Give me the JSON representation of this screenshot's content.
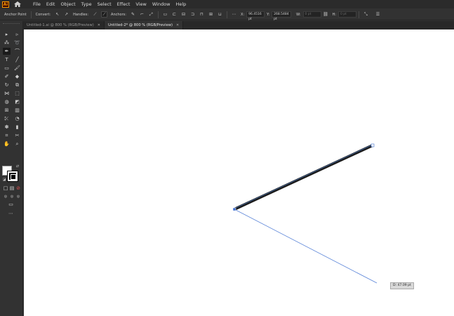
{
  "app": {
    "logo_text": "Ai"
  },
  "menu": [
    "File",
    "Edit",
    "Object",
    "Type",
    "Select",
    "Effect",
    "View",
    "Window",
    "Help"
  ],
  "control_bar": {
    "anchor_label": "Anchor Point",
    "convert_label": "Convert:",
    "handles_label": "Handles:",
    "anchors_label": "Anchors:",
    "x_label": "X:",
    "x_value": "96.4516 pt",
    "y_label": "Y:",
    "y_value": "268.5484 pt",
    "w_label": "W:",
    "w_value": "0 pt",
    "h_label": "H:",
    "h_value": "0 pt"
  },
  "tabs": [
    {
      "label": "Untitled-1.ai @ 800 % (RGB/Preview)",
      "active": false
    },
    {
      "label": "Untitled-2* @ 800 % (RGB/Preview)",
      "active": true
    }
  ],
  "canvas": {
    "distance_tooltip": "D: 47.09 pt"
  },
  "icons": {
    "home": "home-icon",
    "close": "close-icon",
    "more_tools": "more-icon"
  },
  "colors": {
    "brand": "#ff9a00",
    "path_stroke": "#1a1a1a",
    "guide_line": "#3f6fcf"
  }
}
